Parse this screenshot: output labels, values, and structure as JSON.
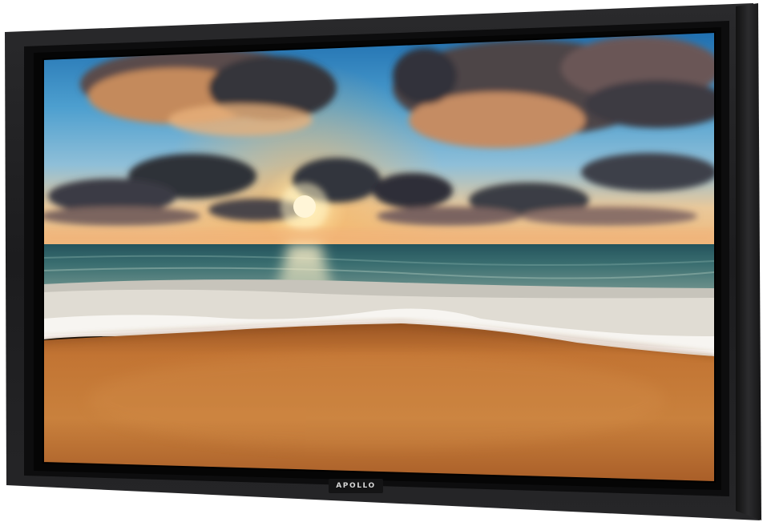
{
  "brand": {
    "logo_text": "APOLLO"
  },
  "colors": {
    "frame_outer": "#1b1b1d",
    "frame_inner": "#0c0c0d",
    "sky_top": "#2f7fc0",
    "sky_horizon": "#f3c88a",
    "sun": "#fff6d8",
    "sea": "#2c5d63",
    "foam": "#f4f2ee",
    "sand": "#c7772f"
  }
}
